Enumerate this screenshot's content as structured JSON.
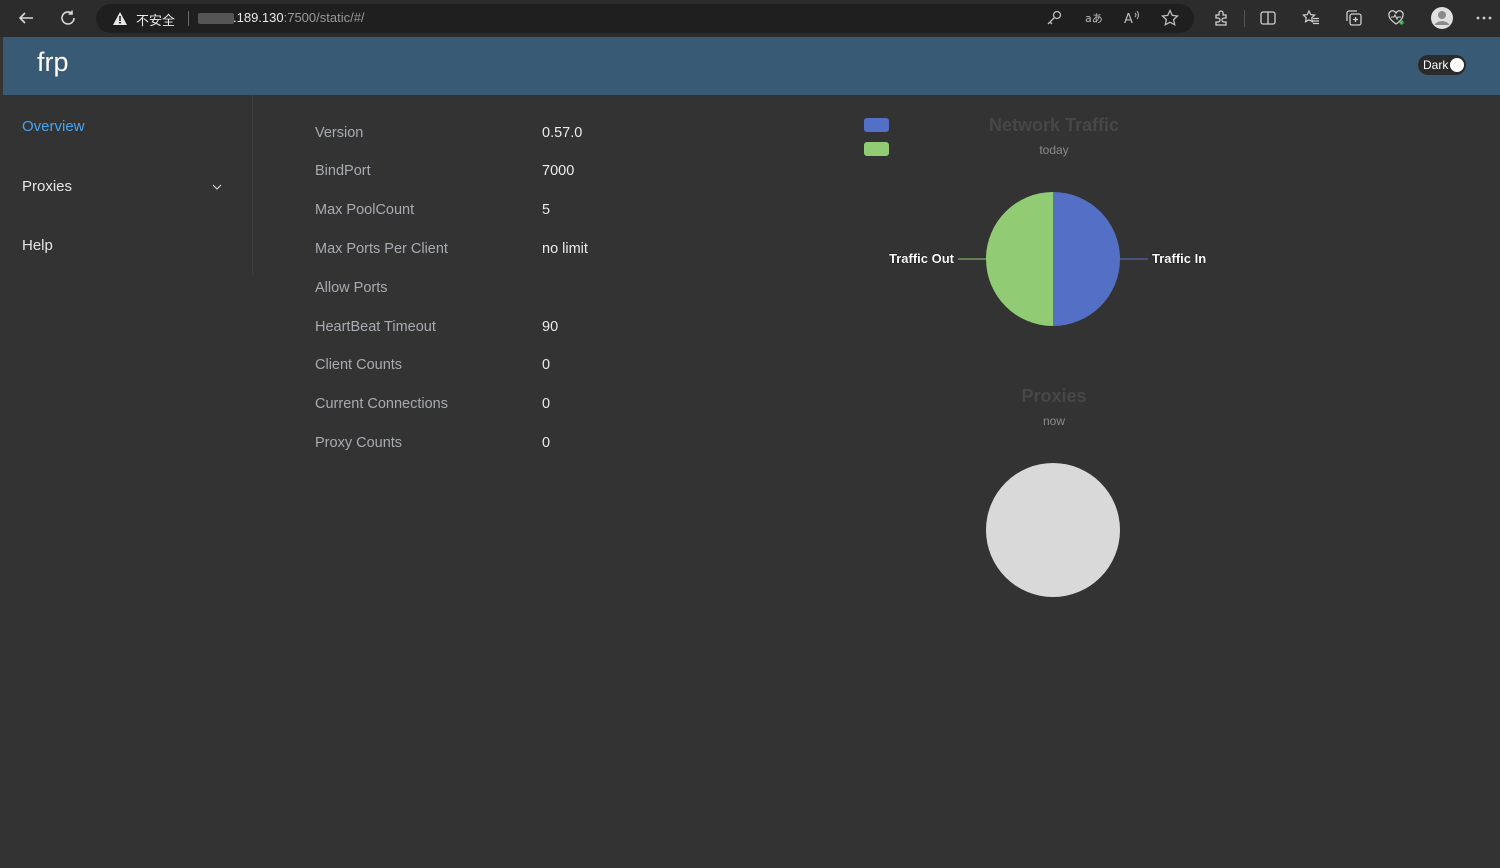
{
  "browser": {
    "insecure_label": "不安全",
    "url_host": ".189.130",
    "url_rest": ":7500/static/#/"
  },
  "header": {
    "brand": "frp",
    "dark_toggle_label": "Dark"
  },
  "sidebar": {
    "items": [
      {
        "label": "Overview",
        "active": true
      },
      {
        "label": "Proxies",
        "active": false
      },
      {
        "label": "Help",
        "active": false
      }
    ]
  },
  "overview": {
    "rows": [
      {
        "label": "Version",
        "value": "0.57.0"
      },
      {
        "label": "BindPort",
        "value": "7000"
      },
      {
        "label": "Max PoolCount",
        "value": "5"
      },
      {
        "label": "Max Ports Per Client",
        "value": "no limit"
      },
      {
        "label": "Allow Ports",
        "value": ""
      },
      {
        "label": "HeartBeat Timeout",
        "value": "90"
      },
      {
        "label": "Client Counts",
        "value": "0"
      },
      {
        "label": "Current Connections",
        "value": "0"
      },
      {
        "label": "Proxy Counts",
        "value": "0"
      }
    ]
  },
  "chart_data": [
    {
      "type": "pie",
      "title": "Network Traffic",
      "subtitle": "today",
      "categories": [
        "Traffic In",
        "Traffic Out"
      ],
      "values": [
        50,
        50
      ],
      "colors": [
        "#5470c6",
        "#91cc75"
      ],
      "legend": "top-left"
    },
    {
      "type": "pie",
      "title": "Proxies",
      "subtitle": "now",
      "categories": [],
      "values": [],
      "empty_color": "#d9d9d9"
    }
  ]
}
